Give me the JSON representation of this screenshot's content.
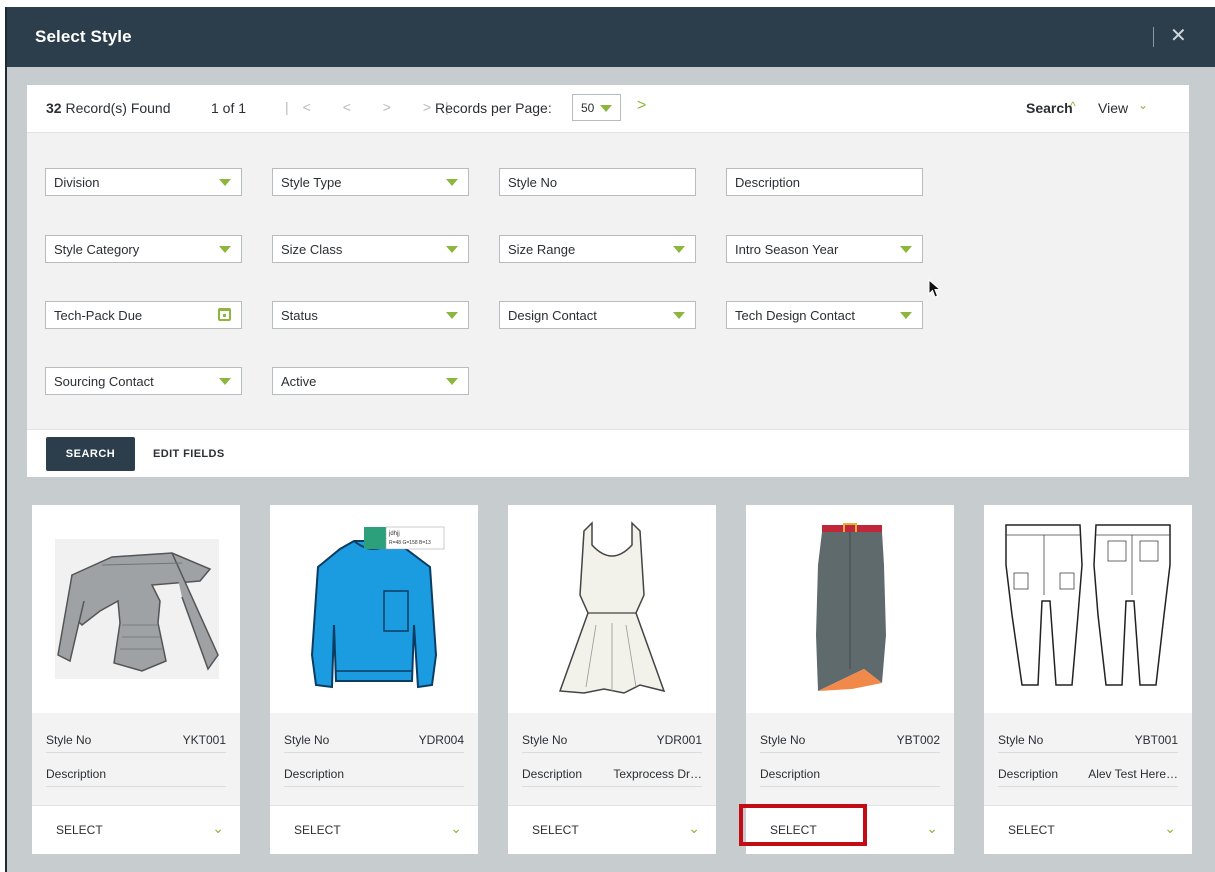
{
  "dialog": {
    "title": "Select Style",
    "close_icon": "close-icon"
  },
  "toolbar": {
    "records_count": "32",
    "records_label": " Record(s) Found",
    "page_info": "1 of 1",
    "pager_glyphs": "|< < > >|",
    "records_per_page_label": "Records per Page:",
    "records_per_page_value": "50",
    "next_glyph": ">",
    "search_label": "Search",
    "view_label": "View"
  },
  "filters": [
    {
      "label": "Division",
      "kind": "select"
    },
    {
      "label": "Style Type",
      "kind": "select"
    },
    {
      "label": "Style No",
      "kind": "text"
    },
    {
      "label": "Description",
      "kind": "text"
    },
    {
      "label": "Style Category",
      "kind": "select"
    },
    {
      "label": "Size Class",
      "kind": "select"
    },
    {
      "label": "Size Range",
      "kind": "select"
    },
    {
      "label": "Intro Season Year",
      "kind": "select"
    },
    {
      "label": "Tech-Pack Due",
      "kind": "date"
    },
    {
      "label": "Status",
      "kind": "select"
    },
    {
      "label": "Design Contact",
      "kind": "select"
    },
    {
      "label": "Tech Design Contact",
      "kind": "select"
    },
    {
      "label": "Sourcing Contact",
      "kind": "select"
    },
    {
      "label": "Active",
      "kind": "select"
    }
  ],
  "actions": {
    "search_button": "SEARCH",
    "edit_fields": "EDIT FIELDS"
  },
  "cards": [
    {
      "style_no_label": "Style No",
      "style_no": "YKT001",
      "description_label": "Description",
      "description": "",
      "select_label": "SELECT",
      "image": "off-shoulder-top"
    },
    {
      "style_no_label": "Style No",
      "style_no": "YDR004",
      "description_label": "Description",
      "description": "",
      "select_label": "SELECT",
      "image": "blue-sweatshirt",
      "swatch_title": "jdhjj",
      "swatch_rgb": "R=48 G=158 B=13"
    },
    {
      "style_no_label": "Style No",
      "style_no": "YDR001",
      "description_label": "Description",
      "description": "Texprocess Dr…",
      "select_label": "SELECT",
      "image": "white-dress"
    },
    {
      "style_no_label": "Style No",
      "style_no": "YBT002",
      "description_label": "Description",
      "description": "",
      "select_label": "SELECT",
      "image": "grey-skirt"
    },
    {
      "style_no_label": "Style No",
      "style_no": "YBT001",
      "description_label": "Description",
      "description": "Alev Test Here…",
      "select_label": "SELECT",
      "image": "jeans-sketch"
    }
  ],
  "colors": {
    "header": "#2c3e4b",
    "accent": "#8cb63c",
    "highlight": "#c10d13"
  }
}
